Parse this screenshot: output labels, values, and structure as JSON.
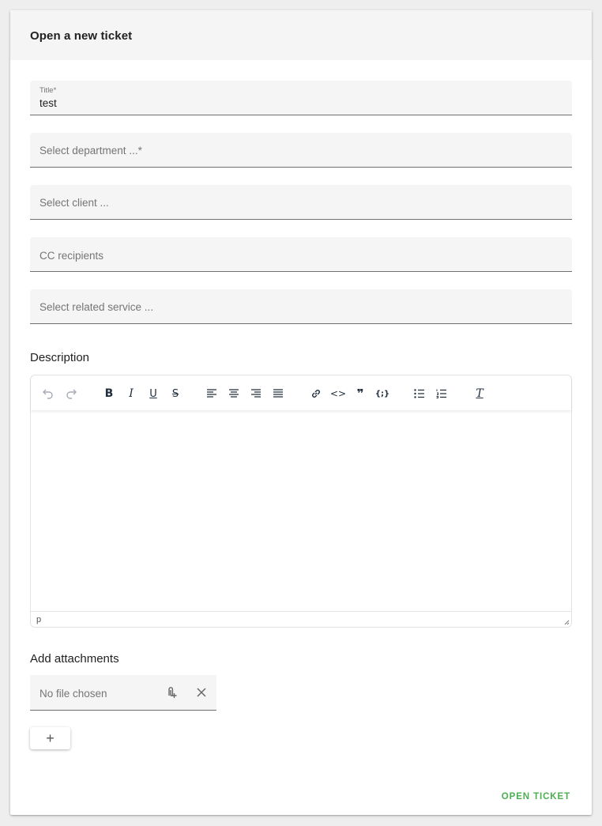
{
  "header": {
    "title": "Open a new ticket"
  },
  "form": {
    "title_label": "Title*",
    "title_value": "test",
    "department_placeholder": "Select department ...*",
    "client_placeholder": "Select client ...",
    "cc_placeholder": "CC recipients",
    "service_placeholder": "Select related service ..."
  },
  "description": {
    "label": "Description",
    "toolbar_icons": [
      "undo-icon",
      "redo-icon",
      "bold-icon",
      "italic-icon",
      "underline-icon",
      "strikethrough-icon",
      "align-left-icon",
      "align-center-icon",
      "align-right-icon",
      "align-justify-icon",
      "link-icon",
      "code-icon",
      "blockquote-icon",
      "code-block-icon",
      "bullet-list-icon",
      "numbered-list-icon",
      "clear-format-icon"
    ],
    "toolbar_text": {
      "bold": "B",
      "italic": "I",
      "underline": "U",
      "strike": "S",
      "code": "<>",
      "quote": "❞",
      "codeblock": "{;}",
      "clear": "T"
    },
    "status_path": "p"
  },
  "attachments": {
    "label": "Add attachments",
    "file_placeholder": "No file chosen",
    "add_label": "+"
  },
  "actions": {
    "submit_label": "OPEN TICKET"
  },
  "colors": {
    "accent": "#4caf50",
    "field_bg": "#f5f5f5",
    "header_bg": "#f5f5f5"
  }
}
